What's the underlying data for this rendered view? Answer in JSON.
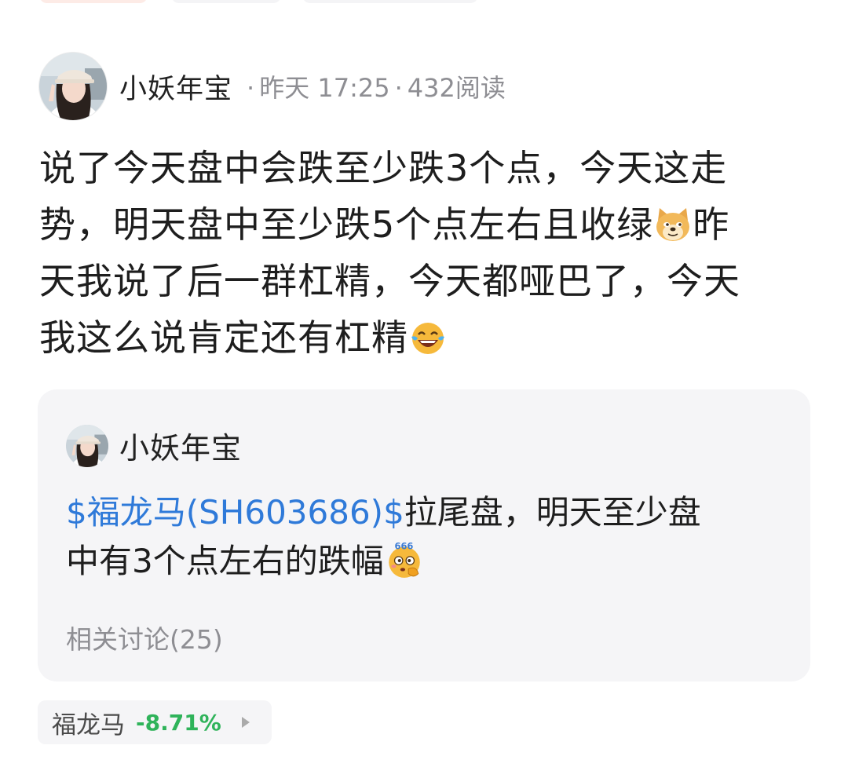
{
  "post": {
    "author": "小妖年宝",
    "time": "昨天 17:25",
    "reads": "432阅读",
    "body_line1": "说了今天盘中会跌至少跌3个点，今天这走",
    "body_line2": "势，明天盘中至少跌5个点左右且收绿",
    "body_line2_end": "昨",
    "body_line3": "天我说了后一群杠精，今天都哑巴了，今天",
    "body_line4": "我这么说肯定还有杠精",
    "emojis": [
      "doge-emoji",
      "laugh-tears-emoji"
    ]
  },
  "quote": {
    "author": "小妖年宝",
    "stock_link": "$福龙马(SH603686)$",
    "text_after_link": "拉尾盘，明天至少盘",
    "text_line2": "中有3个点左右的跌幅",
    "emoji": "666-thinking-emoji",
    "related": "相关讨论(25)"
  },
  "stock_tag": {
    "name": "福龙马",
    "change": "-8.71%",
    "change_color": "#2fb35a",
    "arrow_icon": "play-arrow-icon"
  },
  "colors": {
    "link": "#2f7ad9",
    "meta": "#8e8e93",
    "card_bg": "#f5f5f7"
  }
}
